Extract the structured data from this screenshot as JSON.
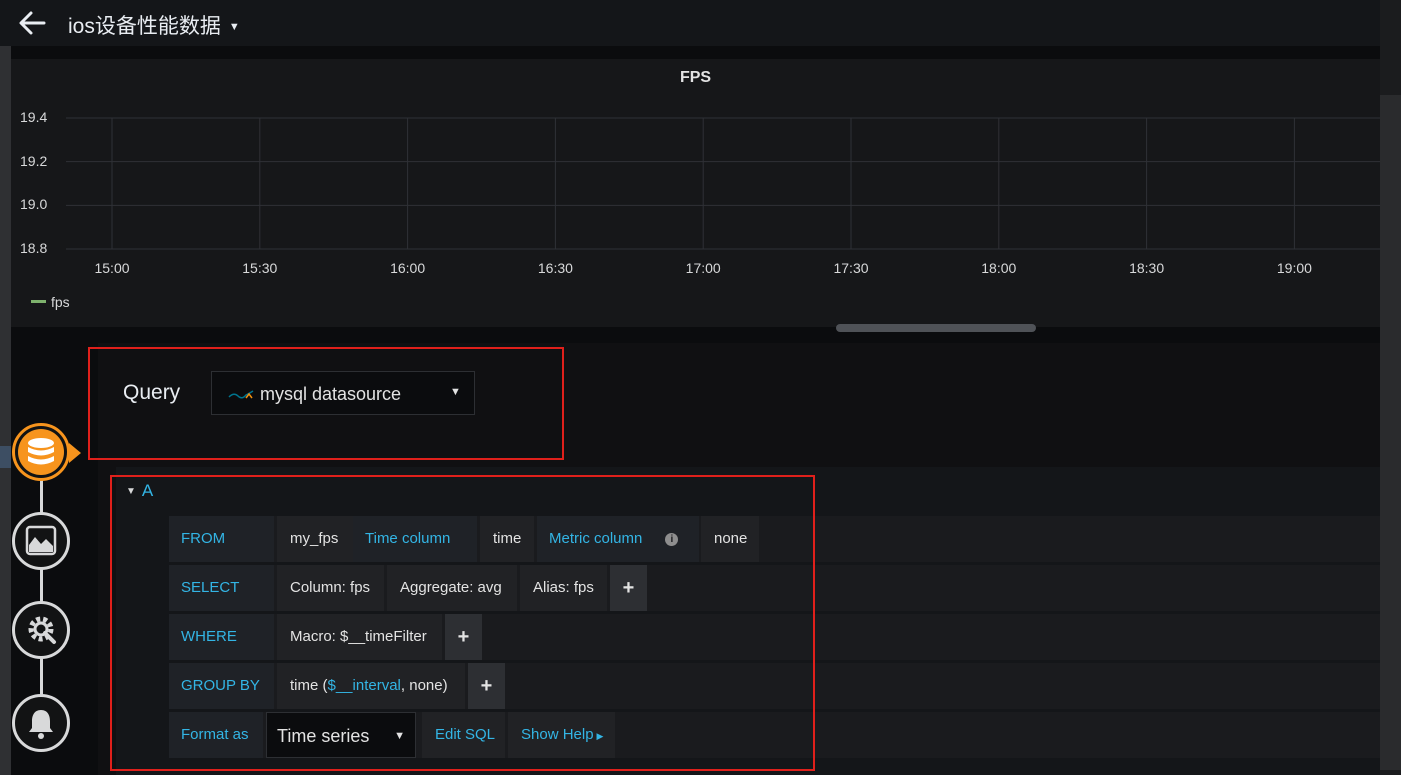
{
  "header": {
    "title": "ios设备性能数据"
  },
  "panel": {
    "title": "FPS"
  },
  "chart_data": {
    "type": "line",
    "title": "FPS",
    "x": [
      "15:00",
      "15:30",
      "16:00",
      "16:30",
      "17:00",
      "17:30",
      "18:00",
      "18:30",
      "19:00"
    ],
    "y_ticks": [
      "19.4",
      "19.2",
      "19.0",
      "18.8"
    ],
    "ylim": [
      18.8,
      19.4
    ],
    "series": [
      {
        "name": "fps",
        "color": "#7eb26d",
        "values": []
      }
    ],
    "grid": true,
    "legend_position": "bottom-left"
  },
  "editor": {
    "query_label": "Query",
    "datasource": "mysql datasource",
    "ref_id": "A",
    "rows": {
      "from": {
        "keyword": "FROM",
        "table": "my_fps",
        "time_column_label": "Time column",
        "time_column": "time",
        "metric_column_label": "Metric column",
        "info_icon": "i",
        "metric_column": "none"
      },
      "select": {
        "keyword": "SELECT",
        "column": "Column: fps",
        "aggregate": "Aggregate: avg",
        "alias": "Alias: fps",
        "add": "+"
      },
      "where": {
        "keyword": "WHERE",
        "macro": "Macro: $__timeFilter",
        "add": "+"
      },
      "group_by": {
        "keyword": "GROUP BY",
        "prefix": "time (",
        "interval": "$__interval",
        "suffix": ", none)",
        "add": "+"
      },
      "format": {
        "keyword": "Format as",
        "value": "Time series",
        "edit_sql": "Edit SQL",
        "show_help": "Show Help"
      }
    }
  },
  "colors": {
    "accent": "#33b5e5",
    "active_step": "#f7941d",
    "annotation": "#e0201b",
    "series": "#7eb26d"
  },
  "icons": {
    "steps": [
      "database-icon",
      "visualization-icon",
      "settings-icon",
      "alert-bell-icon"
    ]
  }
}
